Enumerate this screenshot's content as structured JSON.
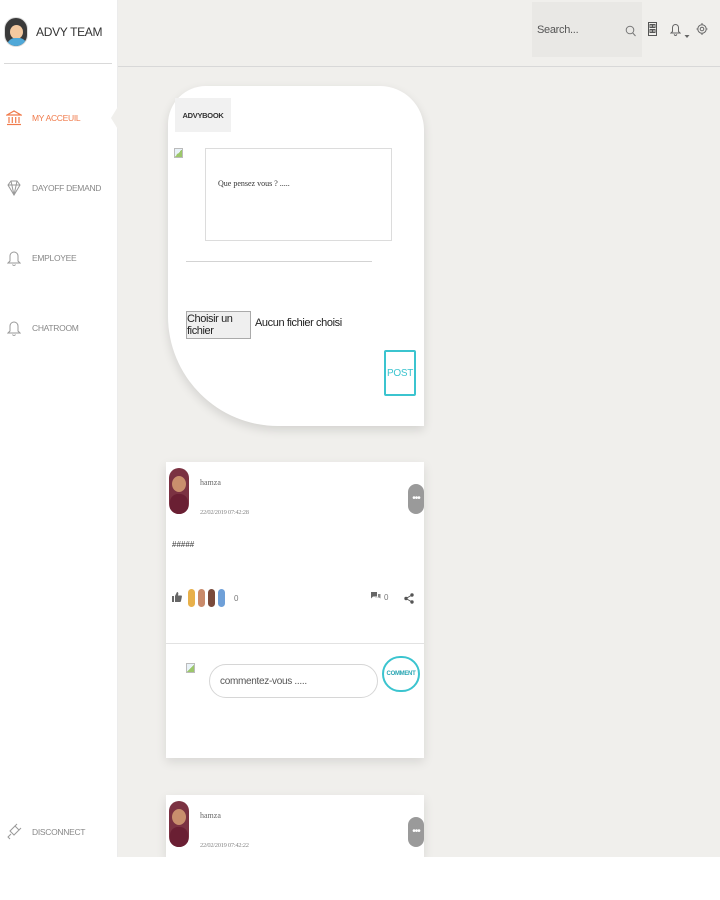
{
  "sidebar": {
    "brand": "ADVY TEAM",
    "items": [
      {
        "label": "MY ACCEUIL",
        "icon": "bank-icon",
        "active": true
      },
      {
        "label": "DAYOFF DEMAND",
        "icon": "diamond-icon",
        "active": false
      },
      {
        "label": "EMPLOYEE",
        "icon": "bell-icon",
        "active": false
      },
      {
        "label": "CHATROOM",
        "icon": "bell-icon",
        "active": false
      }
    ],
    "disconnect": "DISCONNECT"
  },
  "topbar": {
    "search_placeholder": "Search..."
  },
  "composer": {
    "tab": "ADVYBOOK",
    "textarea_placeholder": "Que pensez vous ? .....",
    "file_button": "Choisir un fichier",
    "file_status": "Aucun fichier choisi",
    "post_button": "POST"
  },
  "posts": [
    {
      "author": "hamza",
      "date": "22/02/2019 07:42:28",
      "text": "#####",
      "like_count": "0",
      "comment_count": "0",
      "comment_placeholder": "commentez-vous .....",
      "comment_button": "COMMENT"
    },
    {
      "author": "hamza",
      "date": "22/02/2019 07:42:22"
    }
  ],
  "colors": {
    "accent": "#3bc4cf",
    "active_nav": "#f07a4a",
    "background": "#f0efec"
  }
}
